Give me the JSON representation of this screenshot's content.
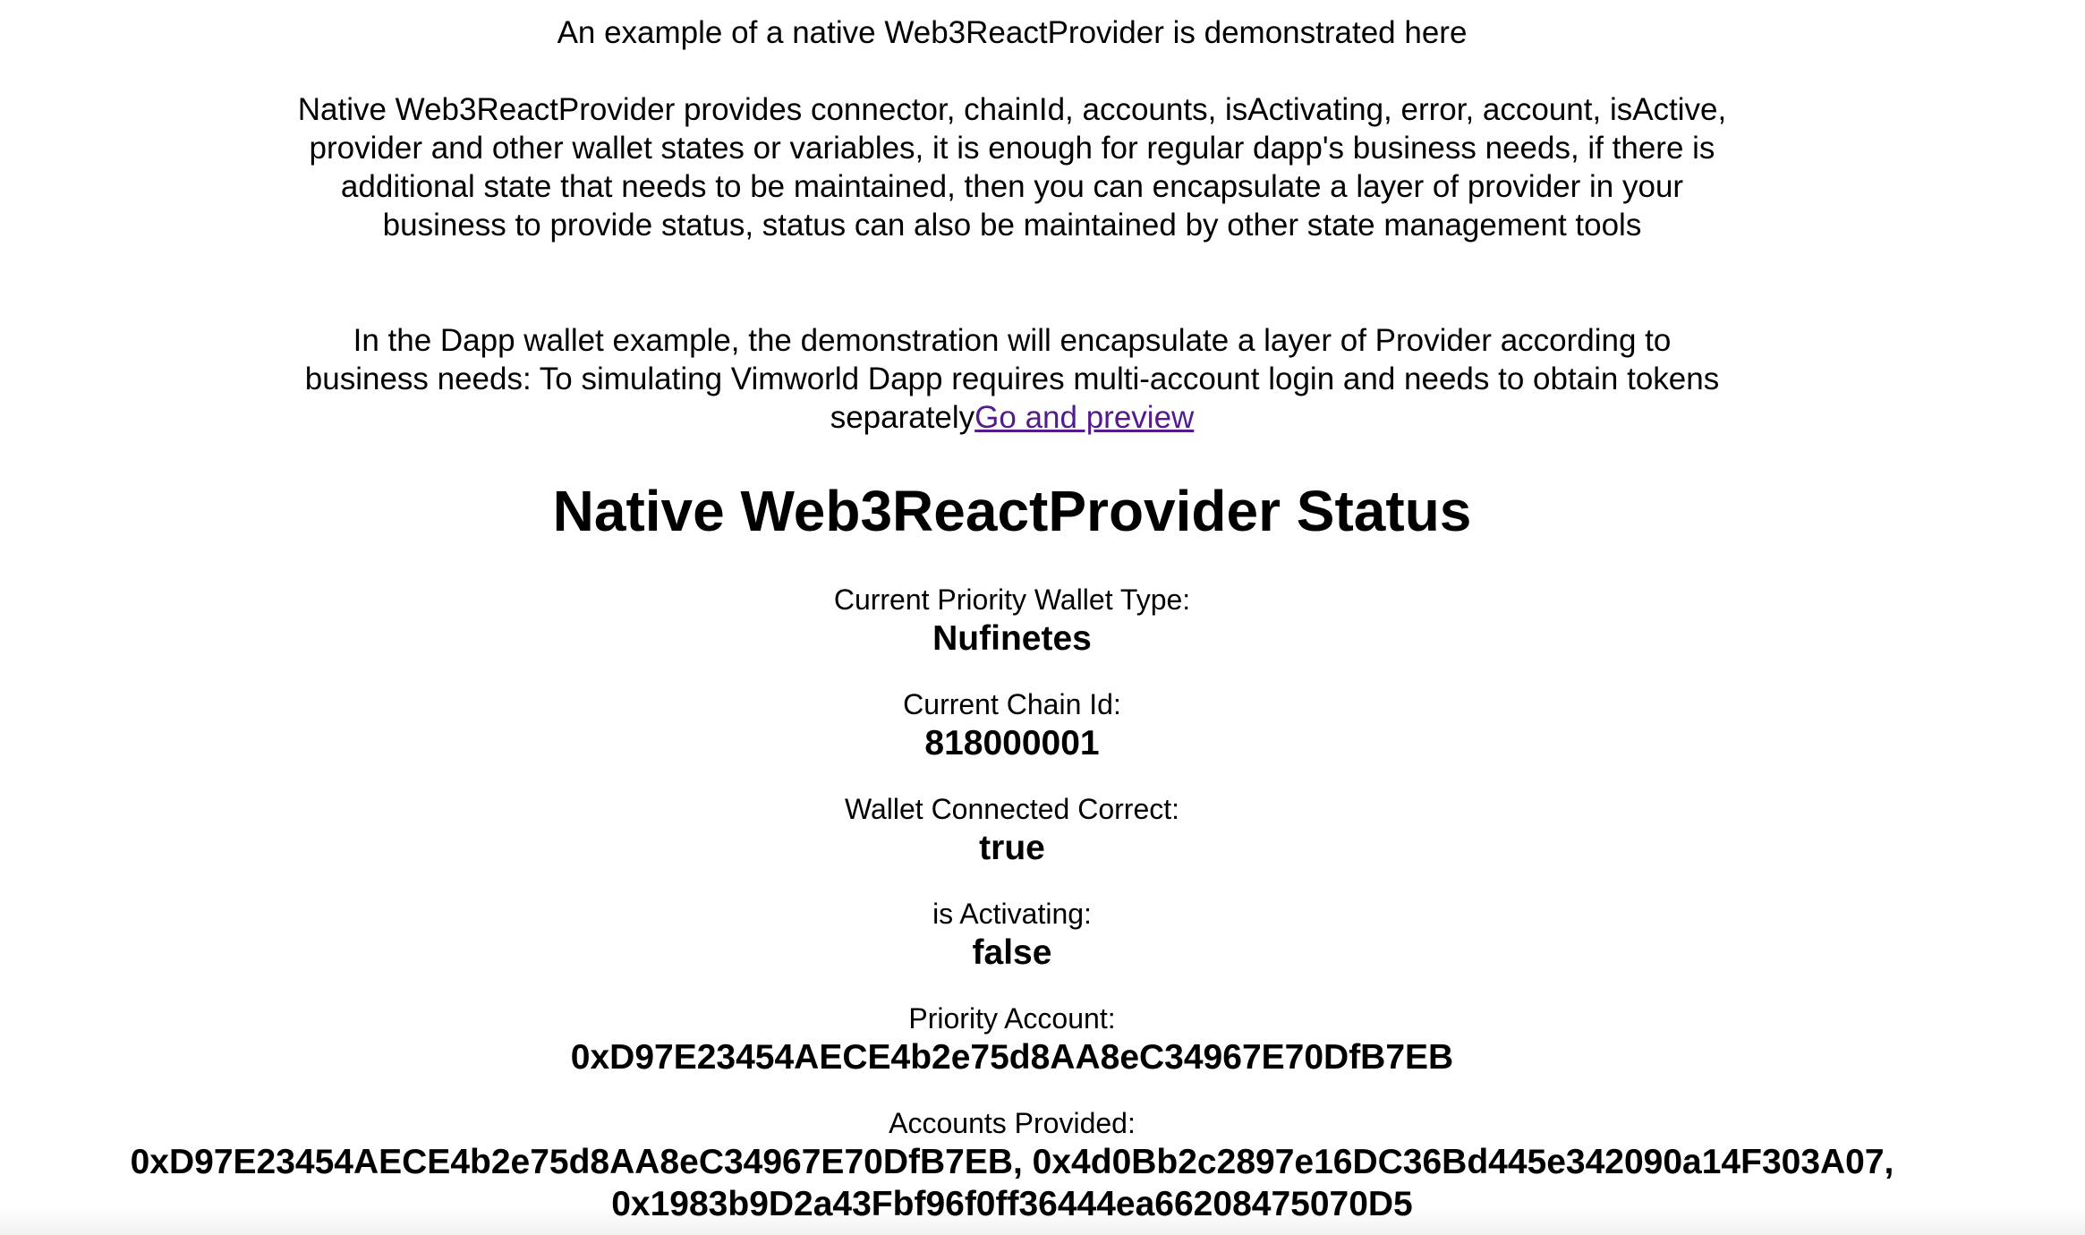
{
  "intro": {
    "line": "An example of a native Web3ReactProvider is demonstrated here",
    "paragraph_1": "Native Web3ReactProvider provides connector, chainId, accounts, isActivating, error, account, isActive, provider and other wallet states or variables, it is enough for regular dapp's business needs, if there is additional state that needs to be maintained, then you can encapsulate a layer of provider in your business to provide status, status can also be maintained by other state management tools",
    "paragraph_2": "In the Dapp wallet example, the demonstration will encapsulate a layer of Provider according to business needs: To simulating Vimworld Dapp requires multi-account login and needs to obtain tokens separately",
    "link_label": "Go and preview"
  },
  "status": {
    "title": "Native Web3ReactProvider Status",
    "wallet_type_label": "Current Priority Wallet Type:",
    "wallet_type_value": "Nufinetes",
    "chain_id_label": "Current Chain Id:",
    "chain_id_value": "818000001",
    "connected_label": "Wallet Connected Correct:",
    "connected_value": "true",
    "activating_label": "is Activating:",
    "activating_value": "false",
    "priority_account_label": "Priority Account:",
    "priority_account_value": "0xD97E23454AECE4b2e75d8AA8eC34967E70DfB7EB",
    "accounts_label": "Accounts Provided:",
    "accounts_value": "0xD97E23454AECE4b2e75d8AA8eC34967E70DfB7EB, 0x4d0Bb2c2897e16DC36Bd445e342090a14F303A07, 0x1983b9D2a43Fbf96f0ff36444ea66208475070D5"
  },
  "colors": {
    "link": "#551a8b",
    "text": "#000000",
    "background": "#ffffff"
  }
}
